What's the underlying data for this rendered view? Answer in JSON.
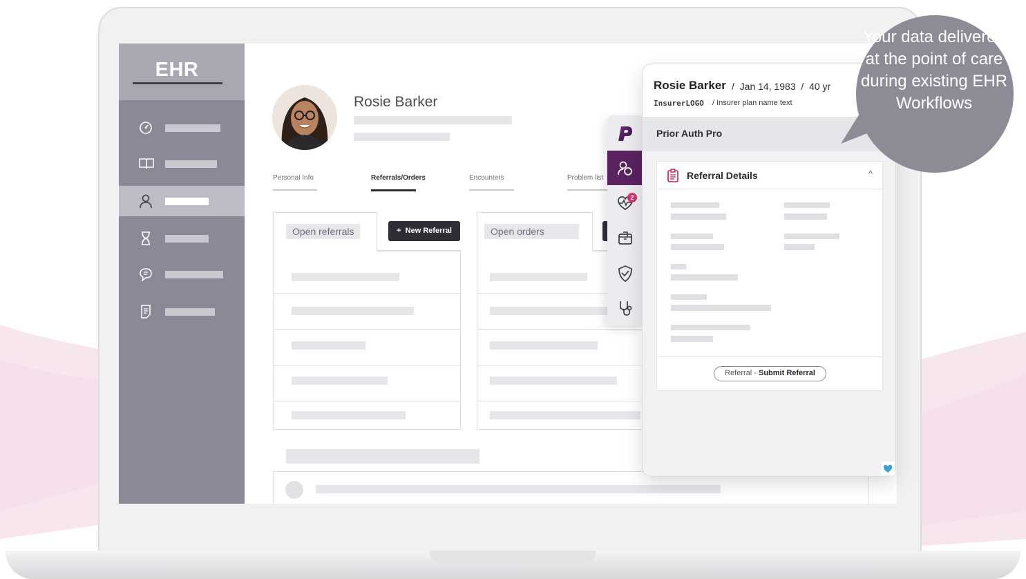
{
  "colors": {
    "sidebar": "#8a8a96",
    "sidebar_active": "#bcbcc4",
    "rail_active": "#5a2360",
    "badge": "#d6336c",
    "bubble": "#8c8c96",
    "clipboard_icon": "#c2185b"
  },
  "ehr": {
    "logo": "EHR",
    "sidebar": {
      "items": [
        {
          "icon": "dashboard-gauge-icon",
          "active": false
        },
        {
          "icon": "book-icon",
          "active": false
        },
        {
          "icon": "person-icon",
          "active": true
        },
        {
          "icon": "hourglass-icon",
          "active": false
        },
        {
          "icon": "chat-icon",
          "active": false
        },
        {
          "icon": "document-icon",
          "active": false
        }
      ]
    },
    "patient": {
      "name": "Rosie Barker"
    },
    "tabs": [
      {
        "label": "Personal Info",
        "active": false
      },
      {
        "label": "Referrals/Orders",
        "active": true
      },
      {
        "label": "Encounters",
        "active": false
      },
      {
        "label": "Problem list",
        "active": false
      }
    ],
    "referrals_card": {
      "label": "Open referrals",
      "button": "New Referral",
      "button_icon": "plus-icon"
    },
    "orders_card": {
      "label": "Open orders"
    }
  },
  "plugin": {
    "patient_name": "Rosie Barker",
    "dob": "Jan 14, 1983",
    "age": "40 yr",
    "separator": "/",
    "insurer_logo": "InsurerLOGO",
    "insurer_plan": "/ Insurer plan name text",
    "app_name": "Prior Auth Pro",
    "rail": {
      "logo_icon": "p-logo-icon",
      "items": [
        {
          "icon": "people-icon",
          "active": true
        },
        {
          "icon": "heart-pulse-icon",
          "badge": "2"
        },
        {
          "icon": "package-icon"
        },
        {
          "icon": "shield-check-icon"
        },
        {
          "icon": "stethoscope-icon"
        }
      ]
    },
    "referral_card": {
      "title": "Referral Details",
      "icon": "clipboard-icon",
      "collapse_icon": "chevron-up-icon",
      "action_prefix": "Referral - ",
      "action_label": "Submit Referral"
    }
  },
  "callout": {
    "text": "Your data delivered at the point of care during existing EHR Workflows"
  }
}
